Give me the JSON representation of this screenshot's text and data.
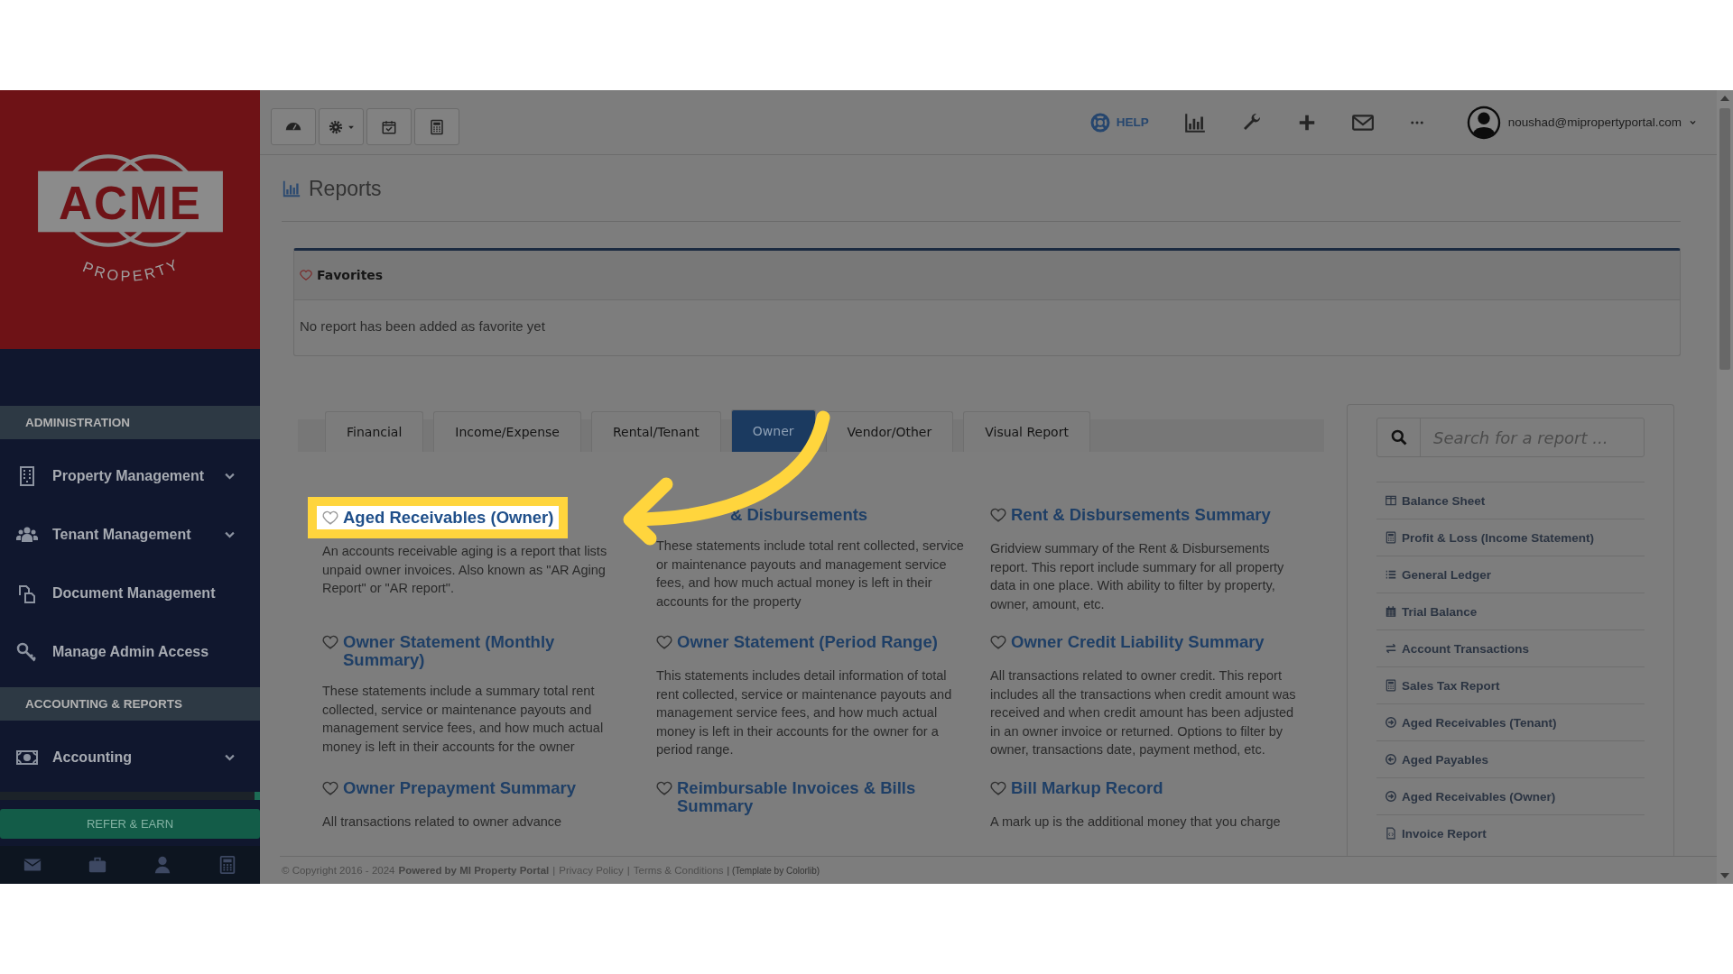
{
  "sidebar": {
    "logo": {
      "wordmark": "ACME",
      "tagline": "PROPERTY"
    },
    "sections": [
      {
        "title": "ADMINISTRATION",
        "items": [
          {
            "label": "Property Management",
            "expandable": true
          },
          {
            "label": "Tenant Management",
            "expandable": true
          },
          {
            "label": "Document Management",
            "expandable": false
          },
          {
            "label": "Manage Admin Access",
            "expandable": false
          }
        ]
      },
      {
        "title": "ACCOUNTING & REPORTS",
        "items": [
          {
            "label": "Accounting",
            "expandable": true
          }
        ]
      }
    ],
    "refer_button": "REFER & EARN"
  },
  "topbar": {
    "help": "HELP",
    "user": "noushad@mipropertyportal.com"
  },
  "page": {
    "title": "Reports"
  },
  "favorites": {
    "title": "Favorites",
    "empty_message": "No report has been added as favorite yet"
  },
  "tabs": [
    {
      "label": "Financial",
      "selected": false
    },
    {
      "label": "Income/Expense",
      "selected": false
    },
    {
      "label": "Rental/Tenant",
      "selected": false
    },
    {
      "label": "Owner",
      "selected": true
    },
    {
      "label": "Vendor/Other",
      "selected": false
    },
    {
      "label": "Visual Report",
      "selected": false
    }
  ],
  "reports": [
    {
      "title": "Aged Receivables (Owner)",
      "description": "An accounts receivable aging is a report that lists unpaid owner invoices. Also known as \"AR Aging Report\" or \"AR report\".",
      "highlighted": true,
      "heart_shown": true
    },
    {
      "title": "& Disbursements",
      "description": "These statements include total rent collected, service or maintenance payouts and management service fees, and how much actual money is left in their accounts for the property",
      "highlighted": false,
      "heart_shown": false
    },
    {
      "title": "Rent & Disbursements Summary",
      "description": "Gridview summary of the Rent & Disbursements report. This report include summary for all property data in one place. With ability to filter by property, owner, amount, etc.",
      "highlighted": false,
      "heart_shown": true
    },
    {
      "title": "Owner Statement (Monthly Summary)",
      "description": "These statements include a summary total rent collected, service or maintenance payouts and management service fees, and how much actual money is left in their accounts for the owner",
      "highlighted": false,
      "heart_shown": true
    },
    {
      "title": "Owner Statement (Period Range)",
      "description": "This statements includes detail information of total rent collected, service or maintenance payouts and management service fees, and how much actual money is left in their accounts for the owner for a period range.",
      "highlighted": false,
      "heart_shown": true
    },
    {
      "title": "Owner Credit Liability Summary",
      "description": "All transactions related to owner credit. This report includes all the transactions when credit amount was received and when credit amount has been adjusted in an owner invoice or returned. Options to filter by owner, transactions date, payment method, etc.",
      "highlighted": false,
      "heart_shown": true
    },
    {
      "title": "Owner Prepayment Summary",
      "description": "All transactions related to owner advance",
      "highlighted": false,
      "heart_shown": true
    },
    {
      "title": "Reimbursable Invoices & Bills Summary",
      "highlighted": false,
      "heart_shown": true
    },
    {
      "title": "Bill Markup Record",
      "description": "A mark up is the additional money that you charge",
      "highlighted": false,
      "heart_shown": true
    }
  ],
  "search": {
    "placeholder": "Search for a report ..."
  },
  "quick_reports": [
    "Balance Sheet",
    "Profit & Loss (Income Statement)",
    "General Ledger",
    "Trial Balance",
    "Account Transactions",
    "Sales Tax Report",
    "Aged Receivables (Tenant)",
    "Aged Payables",
    "Aged Receivables (Owner)",
    "Invoice Report"
  ],
  "footer": [
    {
      "kind": "text",
      "text": "© Copyright 2016 - 2024"
    },
    {
      "kind": "bold",
      "text": "Powered by MI Property Portal"
    },
    {
      "kind": "sep",
      "text": "|"
    },
    {
      "kind": "link",
      "text": "Privacy Policy"
    },
    {
      "kind": "sep",
      "text": "|"
    },
    {
      "kind": "link",
      "text": "Terms & Conditions"
    },
    {
      "kind": "small",
      "text": "| (Template by Colorlib)"
    }
  ]
}
